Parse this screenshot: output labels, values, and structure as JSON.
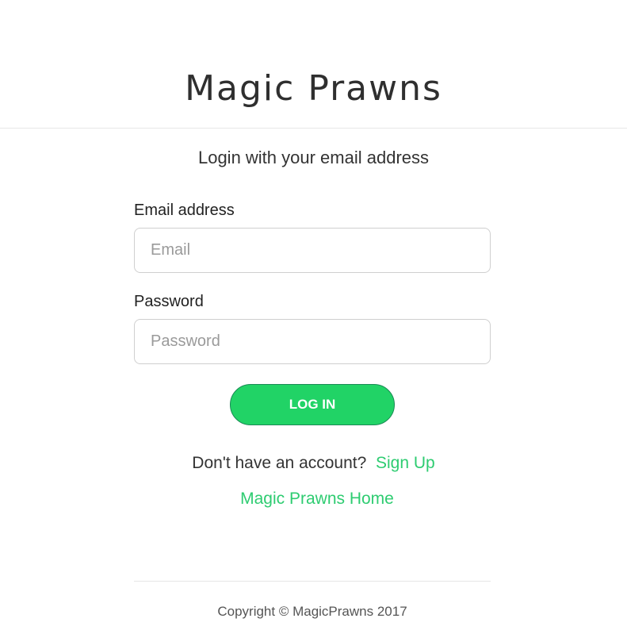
{
  "header": {
    "brand_title": "Magic Prawns"
  },
  "main": {
    "subtitle": "Login with your email address",
    "email": {
      "label": "Email address",
      "placeholder": "Email",
      "value": ""
    },
    "password": {
      "label": "Password",
      "placeholder": "Password",
      "value": ""
    },
    "login_button_label": "LOG IN",
    "signup_prompt": "Don't have an account?",
    "signup_link_label": "Sign Up",
    "home_link_label": "Magic Prawns Home"
  },
  "footer": {
    "copyright": "Copyright © MagicPrawns 2017"
  },
  "colors": {
    "accent": "#21d366",
    "link": "#2ecc71",
    "text": "#333333"
  }
}
